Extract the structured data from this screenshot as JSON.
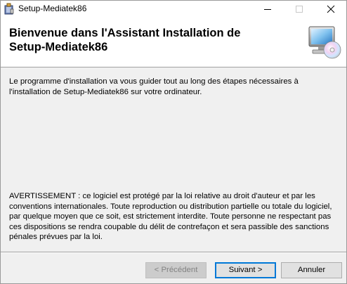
{
  "window": {
    "title": "Setup-Mediatek86",
    "icons": {
      "app": "installer-box-icon",
      "minimize": "minimize-icon",
      "maximize": "maximize-icon",
      "close": "close-icon"
    }
  },
  "header": {
    "line1": "Bienvenue dans l'Assistant Installation de",
    "line2": "Setup-Mediatek86",
    "icon": "computer-cd-icon"
  },
  "body": {
    "intro": "Le programme d'installation va vous guider tout au long des étapes nécessaires à l'installation de Setup-Mediatek86 sur votre ordinateur.",
    "warning": "AVERTISSEMENT : ce logiciel est protégé par la loi relative au droit d'auteur et par les conventions internationales. Toute reproduction ou distribution partielle ou totale du logiciel, par quelque moyen que ce soit, est strictement interdite. Toute personne ne respectant pas ces dispositions se rendra coupable du délit de contrefaçon et sera passible des sanctions pénales prévues par la loi."
  },
  "buttons": {
    "previous": "< Précédent",
    "next": "Suivant >",
    "cancel": "Annuler"
  },
  "colors": {
    "accent": "#0078d7",
    "window_bg": "#f0f0f0",
    "header_bg": "#ffffff"
  }
}
